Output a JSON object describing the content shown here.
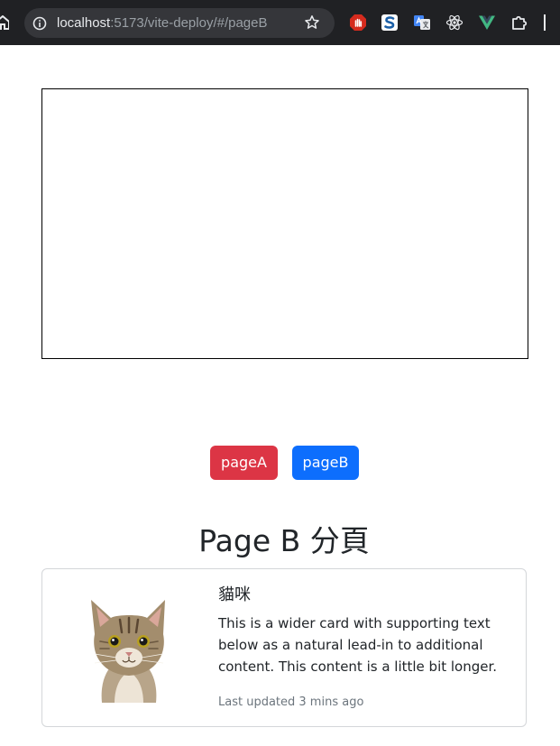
{
  "browser": {
    "url_host": "localhost",
    "url_path": ":5173/vite-deploy/#/pageB",
    "extensions": [
      "adblock-icon",
      "s-extension-icon",
      "google-translate-icon",
      "react-devtools-icon",
      "vue-devtools-icon",
      "extensions-puzzle-icon"
    ]
  },
  "nav": {
    "page_a_label": "pageA",
    "page_b_label": "pageB"
  },
  "page": {
    "title": "Page B 分頁"
  },
  "card": {
    "title": "貓咪",
    "text": "This is a wider card with supporting text below as a natural lead-in to additional content. This content is a little bit longer.",
    "updated": "Last updated 3 mins ago"
  },
  "colors": {
    "danger": "#dc3545",
    "primary": "#0d6efd",
    "chrome_bg": "#202124",
    "address_bg": "#35363a"
  }
}
